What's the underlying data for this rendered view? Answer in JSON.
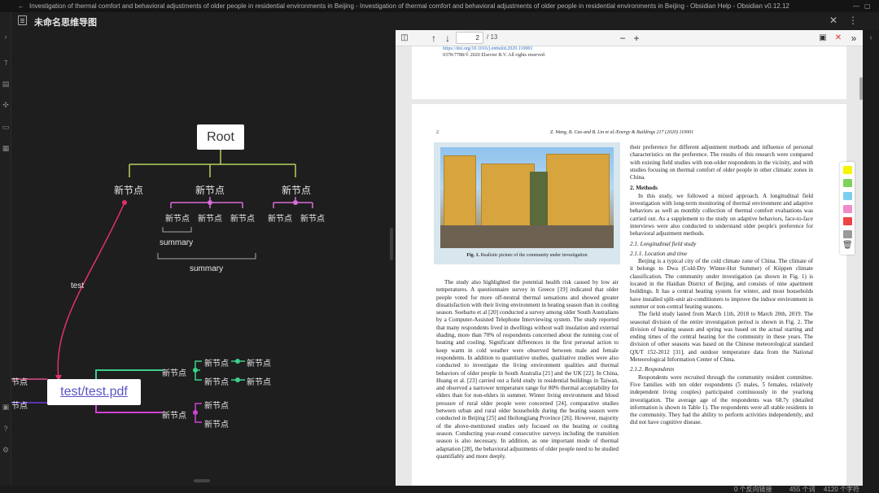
{
  "window": {
    "title": "Investigation of thermal comfort and behavioral adjustments of older people in residential environments in Beijing - Investigation of thermal comfort and behavioral adjustments of older people in residential environments in Beijing - Obsidian Help - Obsidian v0.12.12",
    "back_glyph": "←"
  },
  "left_tab": {
    "title": "未命名思维导图"
  },
  "mindmap": {
    "root": "Root",
    "l1": [
      "新节点",
      "新节点",
      "新节点"
    ],
    "l2_mid": [
      "新节点",
      "新节点",
      "新节点"
    ],
    "l2_right": [
      "新节点",
      "新节点"
    ],
    "summary_inner": "summary",
    "summary_outer": "summary",
    "link_label": "test",
    "file_node": "test/test.pdf",
    "left_cut": [
      "节点",
      "节点"
    ],
    "bottom_branch": {
      "n1": "新节点",
      "n1a": "新节点",
      "n1a1": "新节点",
      "n1b": "新节点",
      "n1b1": "新节点",
      "n2": "新节点",
      "n2a": "新节点",
      "n2b": "新节点"
    }
  },
  "pdf": {
    "page_current": "2",
    "page_total": "/ 13",
    "page1": {
      "doi": "https://doi.org/10.1016/j.enbuild.2020.110001",
      "copyright": "0378-7788/© 2020 Elsevier B.V. All rights reserved."
    },
    "page2": {
      "page_number": "2",
      "running_head": "Z. Wang, B. Cao and B. Lin et al./Energy & Buildings 217 (2020) 110001",
      "fig_caption_label": "Fig. 1.",
      "fig_caption": "Realistic picture of the community under investigation",
      "left_col": [
        "The study also highlighted the potential health risk caused by low air temperatures. A questionnaire survey in Greece [19] indicated that older people voted for more off-neutral thermal sensations and showed greater dissatisfaction with their living environment in heating season than in cooling season. Soebarto et al [20] conducted a survey among older South Australians by a Computer-Assisted Telephone Interviewing system. The study reported that many respondents lived in dwellings without wall insulation and external shading, more than 70% of respondents concerned about the running cost of heating and cooling. Significant differences in the first personal action to keep warm in cold weather were observed between male and female respondents. In addition to quantitative studies, qualitative studies were also conducted to investigate the living environment qualities and thermal behaviors of older people in South Australia [21] and the UK [22]. In China, Huang et al. [23] carried out a field study in residential buildings in Taiwan, and observed a narrower temperature range for 80% thermal acceptability for elders than for non-elders in summer. Winter living environment and blood pressure of rural older people were concerned [24], comparative studies between urban and rural older households during the heating season were conducted in Beijing [25] and Heilongjiang Province [26]. However, majority of the above-mentioned studies only focused on the heating or cooling season. Conducting year-round consecutive surveys including the transition season is also necessary. In addition, as one important mode of thermal adaptation [28], the behavioral adjustments of older people need to be studied quantifiably and more deeply."
      ],
      "right_col_intro": "their preference for different adjustment methods and influence of personal characteristics on the preference. The results of this research were compared with existing field studies with non-older respondents in the vicinity, and with studies focusing on thermal comfort of older people in other climatic zones in China.",
      "sec2_title": "2. Methods",
      "sec2_text": "In this study, we followed a mixed approach. A longitudinal field investigation with long-term monitoring of thermal environment and adaptive behaviors as well as monthly collection of thermal comfort evaluations was carried out. As a supplement to the study on adaptive behaviors, face-to-face interviews were also conducted to understand older people's preference for behavioral adjustment methods.",
      "sec21_title": "2.1. Longitudinal field study",
      "sec211_title": "2.1.1. Location and time",
      "sec211_text": "Beijing is a typical city of the cold climate zone of China. The climate of it belongs to Dwa (Cold-Dry Winter-Hot Summer) of Köppen climate classification. The community under investigation (as shown in Fig. 1) is located in the Haidian District of Beijing, and consists of nine apartment buildings. It has a central heating system for winter, and most households have installed split-unit air-conditioners to improve the indoor environment in summer or non-central heating seasons.",
      "sec211_text2": "The field study lasted from March 11th, 2018 to March 20th, 2019. The seasonal division of the entire investigation period is shown in Fig. 2. The division of heating season and spring was based on the actual starting and ending times of the central heating for the community in these years. The division of other seasons was based on the Chinese meteorological standard QX/T 152-2012 [31], and outdoor temperature data from the National Meteorological Information Center of China.",
      "sec212_title": "2.1.2. Respondents",
      "sec212_text": "Respondents were recruited through the community resident committee. Five families with ten older respondents (5 males, 5 females, relatively independent living couples) participated continuously in the yearlong investigation. The average age of the respondents was 68.7y (detailed information is shown in Table 1). The respondents were all stable residents in the community. They had the ability to perform activities independently, and did not have cognitive disease."
    },
    "highlight_colors": [
      "#f5f500",
      "#7dd35a",
      "#7ccef0",
      "#f08ac8",
      "#ee4444",
      "#9a9a9a"
    ]
  },
  "status": {
    "backlinks": "0 个反向链接",
    "words": "455 个词",
    "chars": "4120 个字符"
  }
}
